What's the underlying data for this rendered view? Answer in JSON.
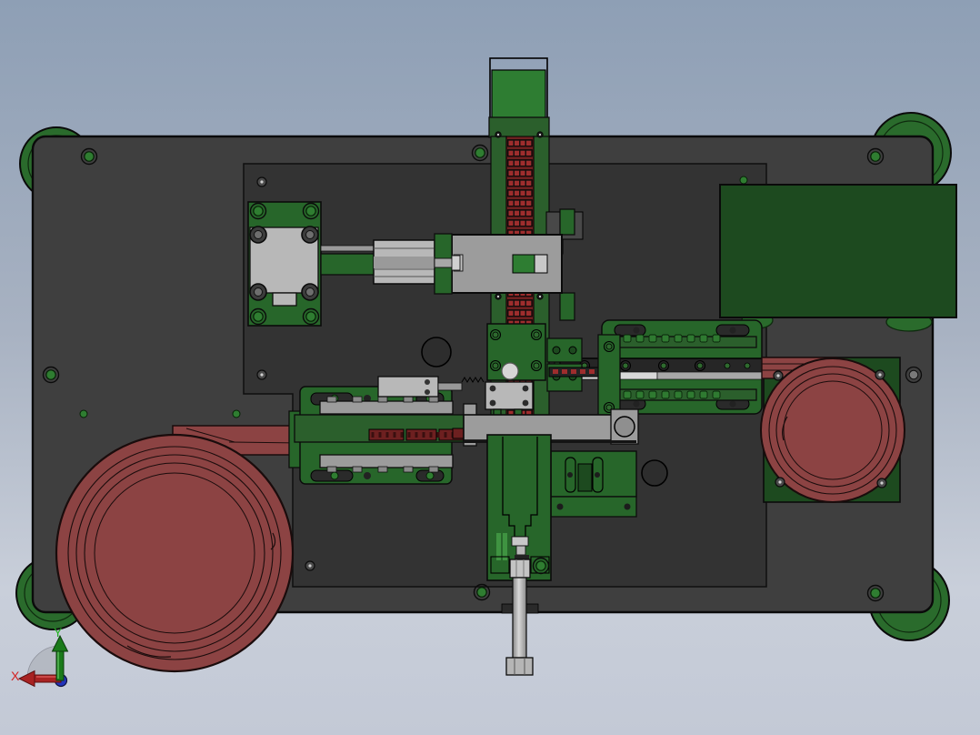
{
  "scene": {
    "description": "CAD top view of an automated assembly machine: dark base plate with green corner feet, two maroon tape reels feeding component strips, central vibratory feeder track with red component rows, pneumatic cylinders, linear stages and a coordinate triad.",
    "view": "top"
  },
  "axis_triad": {
    "x_label": "X",
    "y_label": "Y"
  },
  "colors": {
    "bg_top": "#8e9fb5",
    "bg_mid": "#a8b2c2",
    "bg_low": "#c9cfda",
    "bg_bottom": "#c3c9d6",
    "plate": "#3f3f3f",
    "plate_dark": "#333333",
    "plate_green": "#1d4a1f",
    "comp_green": "#27662a",
    "rail_green": "#2b5f2c",
    "bright_green": "#2e7d32",
    "foot_green": "#2a6b2c",
    "screw_green": "#2f7d31",
    "maroon": "#8c4343",
    "tape_dark": "#6d2020",
    "red_cell": "#9e2d2d",
    "steel": "#9c9c9c",
    "steel_light": "#b8b8b8",
    "axis_red": "#d42222",
    "axis_green_lbl": "#22b022",
    "axis_green": "#1a7a1a",
    "axis_blue": "#2233bb"
  }
}
